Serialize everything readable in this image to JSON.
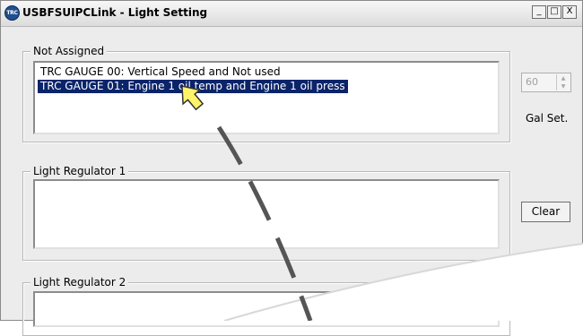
{
  "window": {
    "app_icon_text": "TRC",
    "title": "USBFSUIPCLink - Light Setting",
    "minimize_glyph": "_",
    "maximize_glyph": "□",
    "close_glyph": "X"
  },
  "not_assigned": {
    "label": "Not Assigned",
    "items": [
      "TRC GAUGE 00: Vertical Speed and Not used",
      "TRC GAUGE 01: Engine 1 oil temp and Engine 1 oil press"
    ],
    "selected_index": 1
  },
  "gal_set": {
    "value": "60",
    "label": "Gal Set."
  },
  "light_regulator_1": {
    "label": "Light Regulator 1"
  },
  "light_regulator_2": {
    "label": "Light Regulator 2"
  },
  "clear_label": "Clear"
}
